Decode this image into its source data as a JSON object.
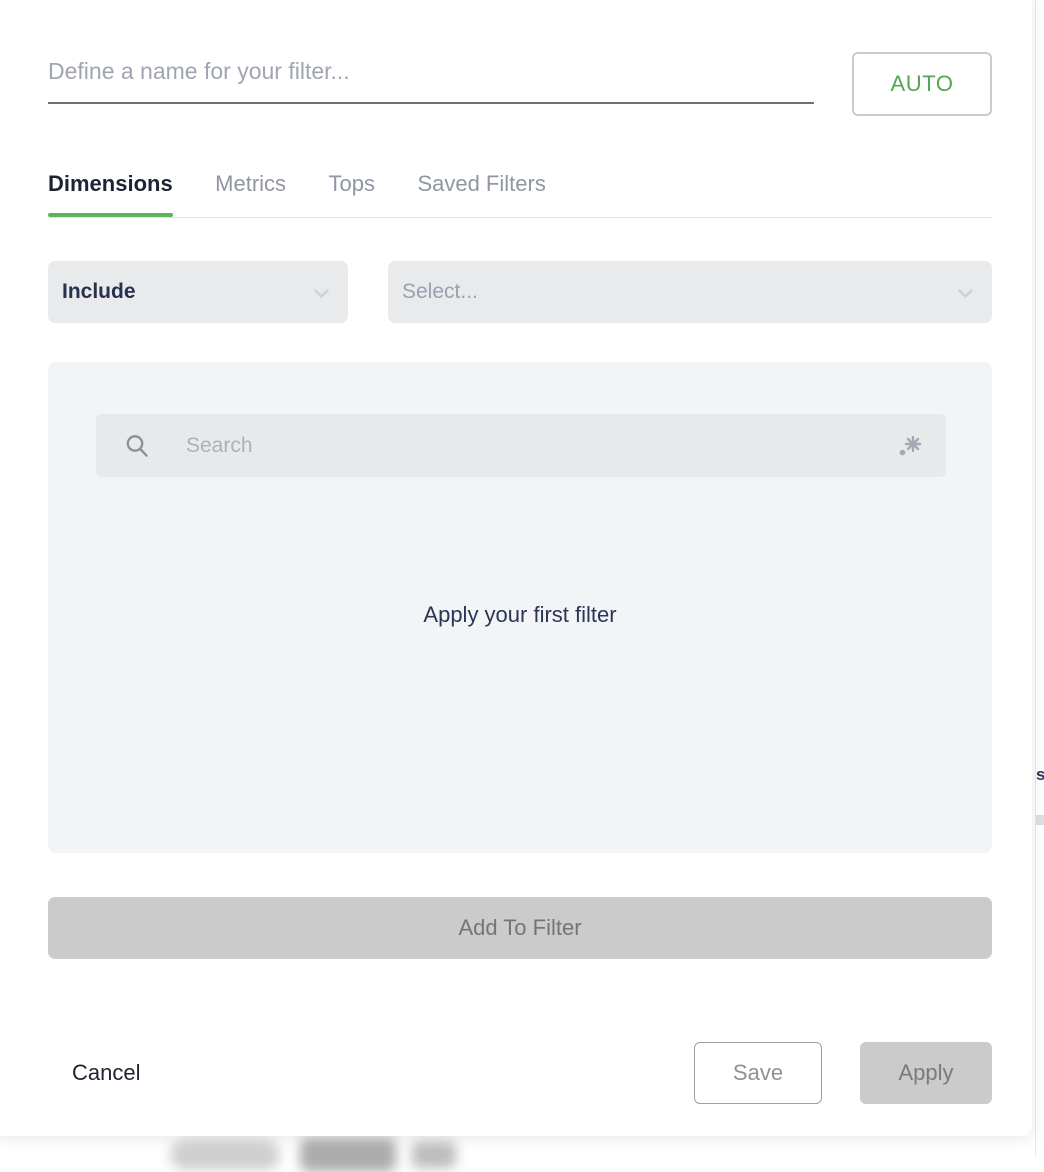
{
  "filter_name": {
    "value": "",
    "placeholder": "Define a name for your filter..."
  },
  "auto_button": {
    "label": "AUTO",
    "color": "#53a653"
  },
  "tabs": [
    {
      "label": "Dimensions",
      "active": true
    },
    {
      "label": "Metrics",
      "active": false
    },
    {
      "label": "Tops",
      "active": false
    },
    {
      "label": "Saved Filters",
      "active": false
    }
  ],
  "selector": {
    "mode": {
      "value": "Include",
      "icon": "chevron-down-icon"
    },
    "field": {
      "placeholder": "Select...",
      "icon": "chevron-down-icon"
    }
  },
  "results": {
    "search": {
      "value": "",
      "placeholder": "Search",
      "leading_icon": "search-icon",
      "trailing_icon": "wildcard-asterisk-icon"
    },
    "empty_message": "Apply your first filter"
  },
  "add_to_filter": {
    "label": "Add To Filter",
    "disabled": true
  },
  "footer": {
    "cancel_label": "Cancel",
    "save_label": "Save",
    "apply_label": "Apply",
    "apply_disabled": true
  },
  "background": {
    "clipped_edge_text": "s"
  },
  "colors": {
    "accent_green": "#5cb25d",
    "panel_bg": "#f3f4f6",
    "field_bg": "#e9eaec",
    "disabled_bg": "#cbcbcb",
    "text_dark": "#2b3556",
    "text_muted": "#9196a3"
  }
}
